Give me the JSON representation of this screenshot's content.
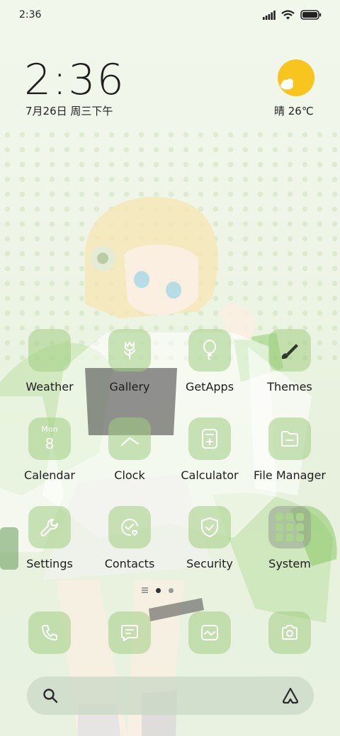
{
  "status": {
    "time": "2:36",
    "icons": [
      "signal-icon",
      "wifi-icon",
      "battery-icon"
    ]
  },
  "widget": {
    "time": "2:36",
    "date": "7月26日 周三下午",
    "weather": "晴 26℃"
  },
  "apps": [
    {
      "label": "Weather",
      "icon": "weather-icon"
    },
    {
      "label": "Gallery",
      "icon": "flower-icon"
    },
    {
      "label": "GetApps",
      "icon": "balloon-icon"
    },
    {
      "label": "Themes",
      "icon": "brush-icon"
    },
    {
      "label": "Calendar",
      "icon": "calendar-icon",
      "month": "Mon",
      "day": "8"
    },
    {
      "label": "Clock",
      "icon": "clock-icon"
    },
    {
      "label": "Calculator",
      "icon": "calculator-icon"
    },
    {
      "label": "File Manager",
      "icon": "folder-icon"
    },
    {
      "label": "Settings",
      "icon": "wrench-icon"
    },
    {
      "label": "Contacts",
      "icon": "contacts-icon"
    },
    {
      "label": "Security",
      "icon": "shield-icon"
    },
    {
      "label": "System",
      "icon": "folder-grid-icon"
    }
  ],
  "dock": [
    {
      "icon": "phone-icon"
    },
    {
      "icon": "messages-icon"
    },
    {
      "icon": "browser-icon"
    },
    {
      "icon": "camera-icon"
    }
  ],
  "pager": {
    "pages": 3,
    "current": 2
  },
  "search": {
    "left_icon": "search-icon",
    "right_icon": "assistant-icon"
  },
  "colors": {
    "tile": "#a0cd82",
    "sun": "#f7c51e",
    "text": "#1d1d1d"
  }
}
